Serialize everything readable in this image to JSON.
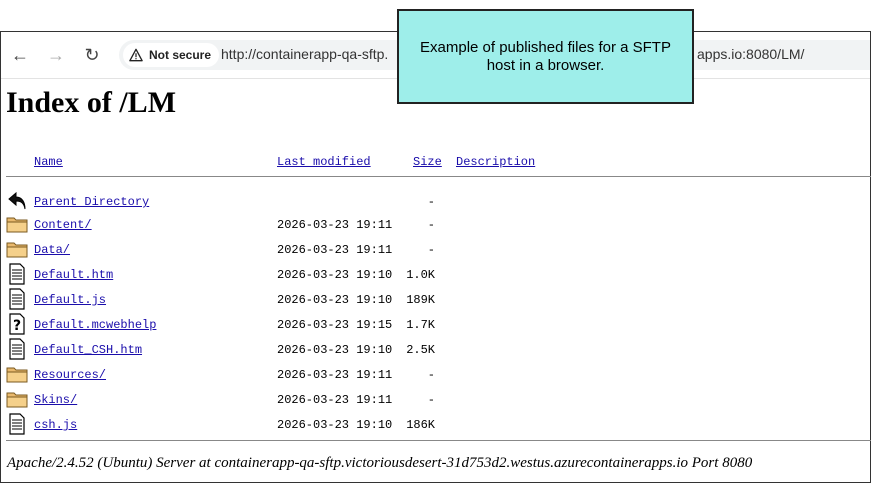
{
  "browser": {
    "security_label": "Not secure",
    "url_left": "http://containerapp-qa-sftp.",
    "url_right": "apps.io:8080/LM/"
  },
  "callout": {
    "text": "Example of published files for a SFTP host in a browser."
  },
  "page": {
    "title": "Index of /LM",
    "columns": {
      "name": "Name",
      "last_modified": "Last modified",
      "size": "Size",
      "description": "Description"
    },
    "entries": [
      {
        "icon": "back-icon",
        "name": "Parent Directory",
        "date": "",
        "size": "-"
      },
      {
        "icon": "folder-icon",
        "name": "Content/",
        "date": "2026-03-23 19:11",
        "size": "-"
      },
      {
        "icon": "folder-icon",
        "name": "Data/",
        "date": "2026-03-23 19:11",
        "size": "-"
      },
      {
        "icon": "text-file-icon",
        "name": "Default.htm",
        "date": "2026-03-23 19:10",
        "size": "1.0K"
      },
      {
        "icon": "text-file-icon",
        "name": "Default.js",
        "date": "2026-03-23 19:10",
        "size": "189K"
      },
      {
        "icon": "unknown-file-icon",
        "name": "Default.mcwebhelp",
        "date": "2026-03-23 19:15",
        "size": "1.7K"
      },
      {
        "icon": "text-file-icon",
        "name": "Default_CSH.htm",
        "date": "2026-03-23 19:10",
        "size": "2.5K"
      },
      {
        "icon": "folder-icon",
        "name": "Resources/",
        "date": "2026-03-23 19:11",
        "size": "-"
      },
      {
        "icon": "folder-icon",
        "name": "Skins/",
        "date": "2026-03-23 19:11",
        "size": "-"
      },
      {
        "icon": "text-file-icon",
        "name": "csh.js",
        "date": "2026-03-23 19:10",
        "size": "186K"
      }
    ],
    "footer": "Apache/2.4.52 (Ubuntu) Server at containerapp-qa-sftp.victoriousdesert-31d753d2.westus.azurecontainerapps.io Port 8080"
  }
}
